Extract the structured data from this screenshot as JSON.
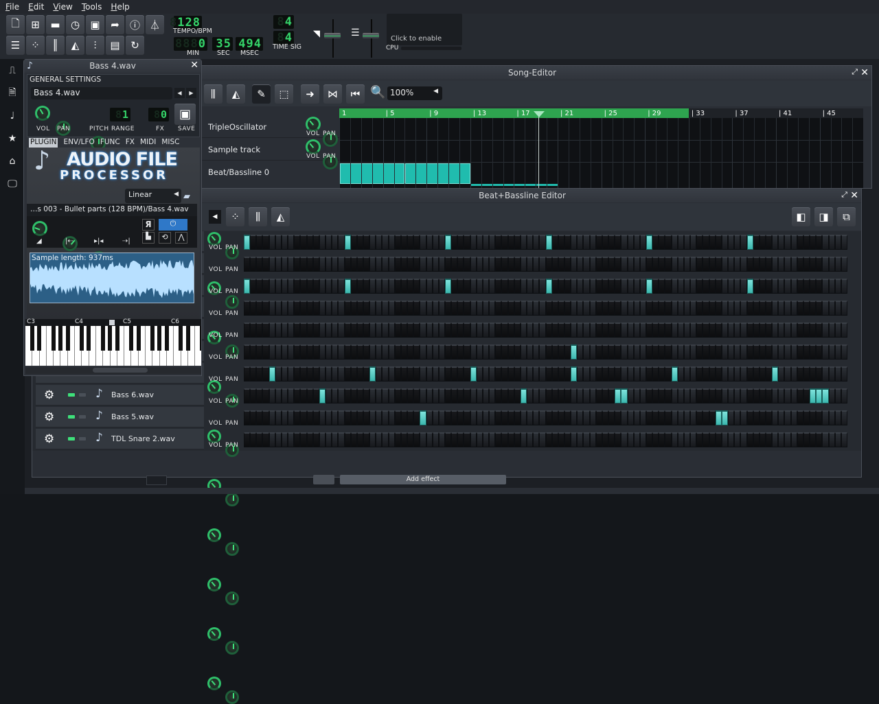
{
  "menu": [
    "File",
    "Edit",
    "View",
    "Tools",
    "Help"
  ],
  "toolbar": {
    "row1_icons": [
      "new-project-icon",
      "new-from-template-icon",
      "open-project-icon",
      "recent-projects-icon",
      "save-icon",
      "export-icon",
      "what-is-this-icon",
      "metronome-icon"
    ],
    "row2_icons": [
      "song-editor-icon",
      "beat-bassline-icon",
      "piano-roll-icon",
      "automation-editor-icon",
      "mixer-icon",
      "project-notes-icon",
      "controller-rack-icon"
    ],
    "tempo": {
      "value": "128",
      "label": "TEMPO/BPM"
    },
    "time": {
      "min": "0",
      "sec": "35",
      "msec": "494",
      "min_label": "MIN",
      "sec_label": "SEC",
      "msec_label": "MSEC"
    },
    "time_sig": {
      "numerator": "4",
      "denominator": "4",
      "label": "TIME SIG"
    },
    "cpu": {
      "hint": "Click to enable",
      "label": "CPU",
      "load": 0
    }
  },
  "sidebar_icons": [
    "instrument-plugins-icon",
    "my-projects-icon",
    "my-samples-icon",
    "my-presets-icon",
    "my-home-icon",
    "my-computer-icon"
  ],
  "instrument_window": {
    "title": "Bass 4.wav",
    "general_settings_label": "GENERAL SETTINGS",
    "name_value": "Bass 4.wav",
    "knobs": [
      {
        "label": "VOL"
      },
      {
        "label": "PAN"
      },
      {
        "label": "PITCH"
      }
    ],
    "range_label": "RANGE",
    "range_value": "1",
    "fx_label": "FX",
    "fx_value": "0",
    "save_label": "SAVE",
    "tabs": [
      "PLUGIN",
      "ENV/LFO",
      "FUNC",
      "FX",
      "MIDI",
      "MISC"
    ],
    "active_tab": "PLUGIN",
    "plugin": {
      "logo_line1": "AUDIO FILE",
      "logo_line2": "PROCESSOR",
      "interpolation": "Linear",
      "file_path": "…s 003 - Bullet parts (128 BPM)/Bass 4.wav",
      "sample_length": "Sample length: 937ms"
    },
    "piano_labels": [
      "C3",
      "C4",
      "C5",
      "C6"
    ]
  },
  "song_editor": {
    "title": "Song-Editor",
    "zoom": "100%",
    "timeline": [
      "1",
      "5",
      "9",
      "13",
      "17",
      "21",
      "25",
      "29",
      "33",
      "37",
      "41",
      "45"
    ],
    "loop_end_bar": 33,
    "playhead_bar": 19,
    "tracks": [
      {
        "name": "TripleOscillator",
        "vol_label": "VOL",
        "pan_label": "PAN"
      },
      {
        "name": "Sample track",
        "vol_label": "VOL",
        "pan_label": "PAN"
      },
      {
        "name": "Beat/Bassline 0"
      }
    ]
  },
  "bb_editor": {
    "title": "Beat+Bassline Editor",
    "steps": 96,
    "tracks": [
      {
        "name": "",
        "active": [
          0,
          16,
          32,
          48,
          64,
          80
        ]
      },
      {
        "name": "",
        "active": []
      },
      {
        "name": "",
        "active": [
          0,
          16,
          32,
          48,
          64,
          80
        ]
      },
      {
        "name": "",
        "active": []
      },
      {
        "name": "",
        "active": []
      },
      {
        "name": "",
        "active": [
          52
        ]
      },
      {
        "name": "",
        "active": [
          4,
          20,
          36,
          52,
          68,
          84
        ]
      },
      {
        "name": "Bass 6.wav",
        "active": [
          12,
          44,
          59,
          60,
          90,
          91,
          92
        ]
      },
      {
        "name": "Bass 5.wav",
        "active": [
          28,
          75,
          76
        ]
      },
      {
        "name": "TDL Snare 2.wav",
        "active": []
      }
    ],
    "vol_label": "VOL",
    "pan_label": "PAN"
  },
  "fx_rack": {
    "add_effect_label": "Add effect"
  },
  "colors": {
    "accent_green": "#2ea44f",
    "pattern_teal": "#20bcae",
    "lcd_green": "#35d56a"
  }
}
